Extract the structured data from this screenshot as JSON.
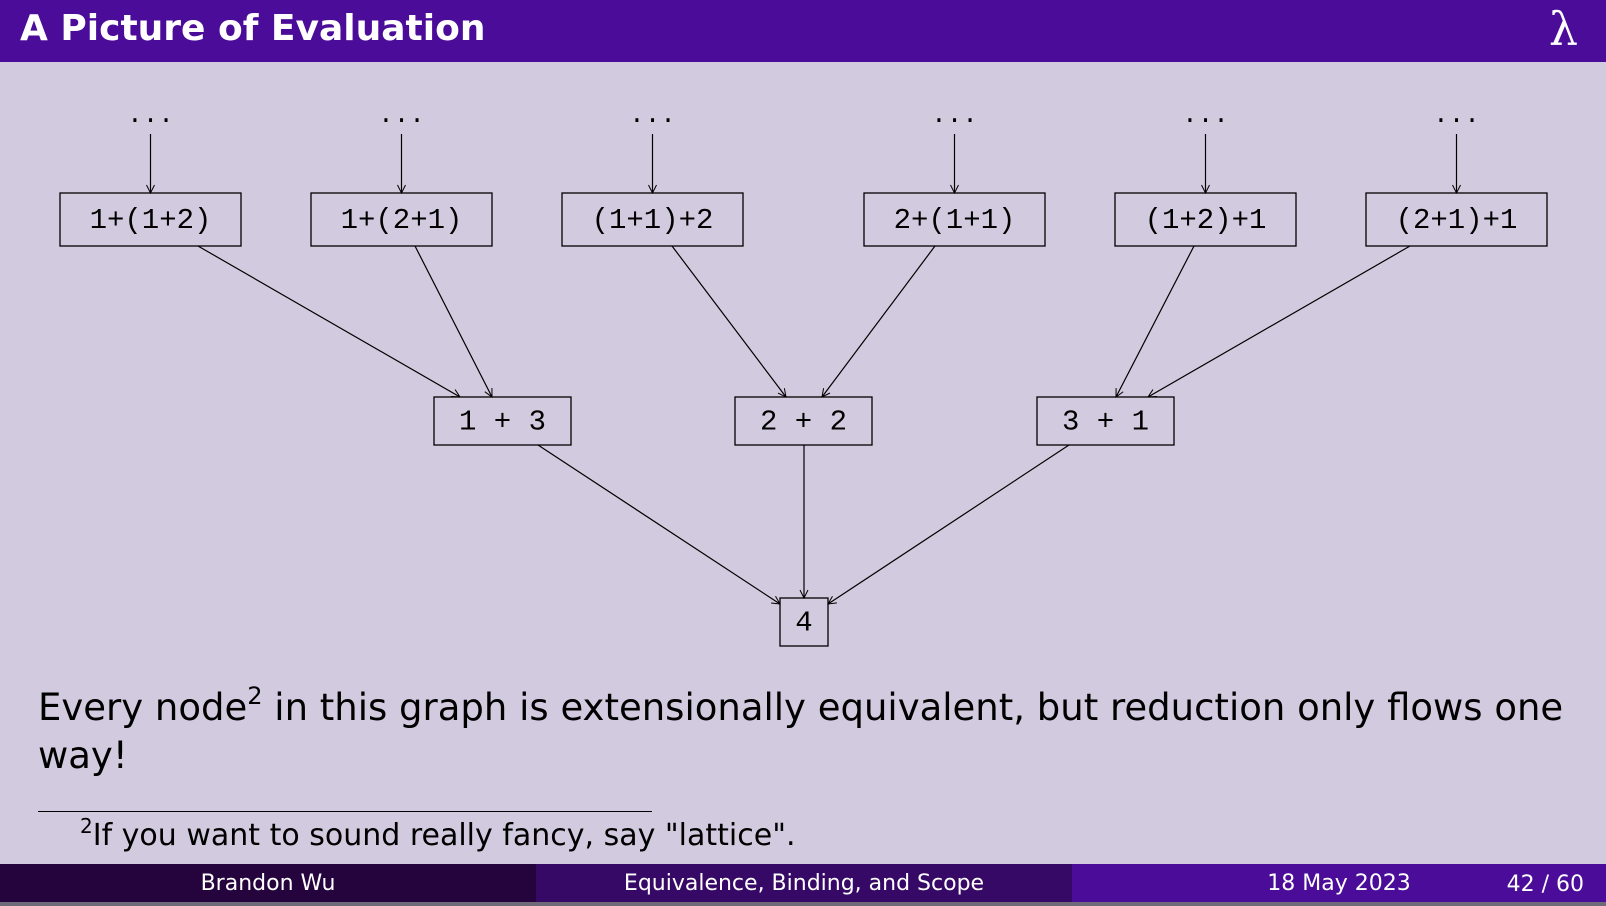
{
  "header": {
    "title": "A Picture of Evaluation",
    "logo_symbol": "λ"
  },
  "diagram": {
    "top_nodes": [
      "1+(1+2)",
      "1+(2+1)",
      "(1+1)+2",
      "2+(1+1)",
      "(1+2)+1",
      "(2+1)+1"
    ],
    "ellipsis": "...",
    "middle_nodes": [
      "1 + 3",
      "2 + 2",
      "3 + 1"
    ],
    "bottom_node": "4"
  },
  "body": {
    "text_before_sup": "Every node",
    "sup": "2",
    "text_after_sup": " in this graph is extensionally equivalent, but reduction only flows one way!"
  },
  "footnote": {
    "marker": "2",
    "text": "If you want to sound really fancy, say \"lattice\"."
  },
  "footer": {
    "author": "Brandon Wu",
    "talk_title": "Equivalence, Binding, and Scope",
    "date": "18 May 2023",
    "page": "42 / 60"
  },
  "colors": {
    "header_bg": "#4b0c99",
    "slide_bg": "#d2cbdf",
    "footer_left": "#25043d",
    "footer_mid": "#370966",
    "footer_right": "#4b0c99"
  }
}
